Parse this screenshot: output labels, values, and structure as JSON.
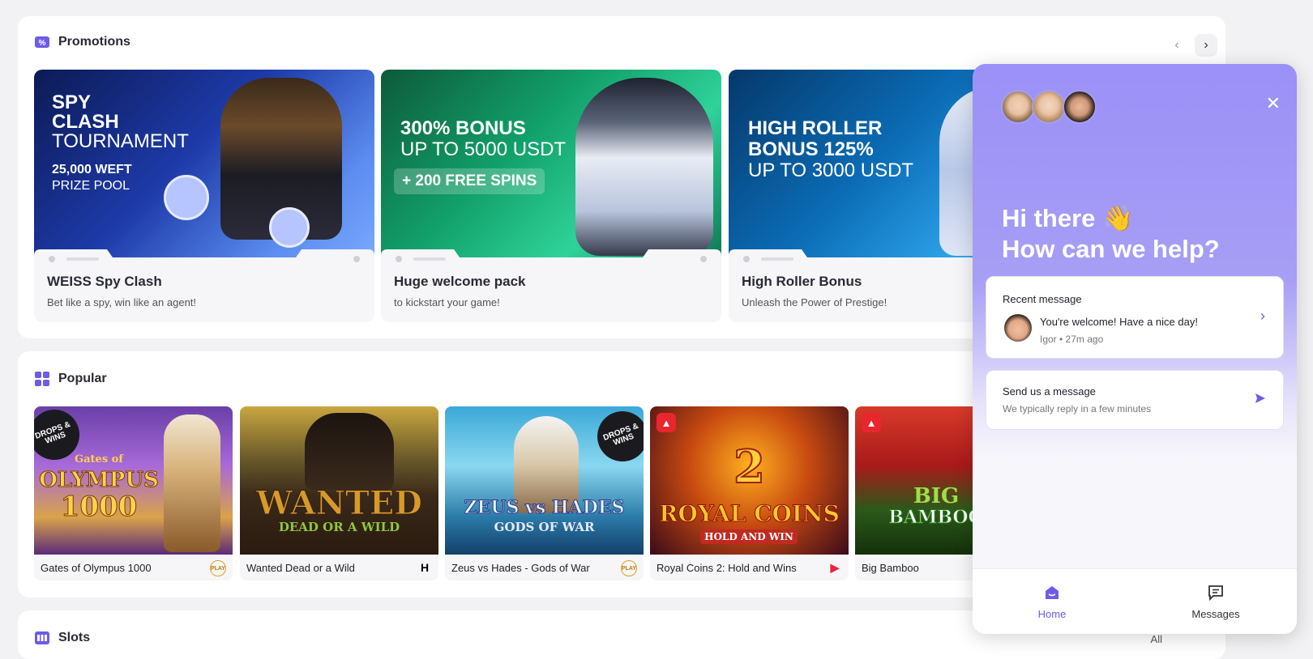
{
  "promotions": {
    "title": "Promotions",
    "cards": [
      {
        "banner_line1": "SPY",
        "banner_line2": "CLASH",
        "banner_line3": "TOURNAMENT",
        "banner_line4": "25,000 WEFT",
        "banner_line5": "PRIZE POOL",
        "title": "WEISS Spy Clash",
        "subtitle": "Bet like a spy, win like an agent!"
      },
      {
        "banner_line1": "300% BONUS",
        "banner_line2": "UP TO 5000 USDT",
        "banner_line3": "+ 200 FREE SPINS",
        "title": "Huge welcome pack",
        "subtitle": "to kickstart your game!"
      },
      {
        "banner_line1": "HIGH ROLLER",
        "banner_line2": "BONUS 125%",
        "banner_line3": "UP TO 3000 USDT",
        "title": "High Roller Bonus",
        "subtitle": "Unleash the Power of Prestige!"
      }
    ],
    "prev_icon": "‹",
    "next_icon": "›"
  },
  "popular": {
    "title": "Popular",
    "games": [
      {
        "name": "Gates of Olympus 1000",
        "art_line1": "Gates of",
        "art_line2": "OLYMPUS",
        "art_line3": "1000",
        "badge": "DROPS & WINS",
        "provider": "PLAY"
      },
      {
        "name": "Wanted Dead or a Wild",
        "art_line1": "WANTED",
        "art_line2": "DEAD OR A WILD",
        "provider": "H"
      },
      {
        "name": "Zeus vs Hades - Gods of War",
        "art_line1": "ZEUS vs HADES",
        "art_line2": "GODS OF WAR",
        "badge": "DROPS & WINS",
        "provider": "PLAY"
      },
      {
        "name": "Royal Coins 2: Hold and Wins",
        "art_line1": "2",
        "art_line2": "ROYAL COINS",
        "art_line3": "HOLD AND WIN",
        "provider": "▶"
      },
      {
        "name": "Big Bamboo",
        "art_line1": "BIG",
        "art_line2": "BAMBOO",
        "provider": ""
      }
    ]
  },
  "slots": {
    "title": "Slots",
    "all_label": "All"
  },
  "chat": {
    "greeting_line1": "Hi there 👋",
    "greeting_line2": "How can we help?",
    "close_icon": "✕",
    "recent": {
      "heading": "Recent message",
      "message": "You're welcome! Have a nice day!",
      "meta": "Igor • 27m ago"
    },
    "send": {
      "title": "Send us a message",
      "subtitle": "We typically reply in a few minutes"
    },
    "tabs": {
      "home": "Home",
      "messages": "Messages"
    },
    "colors": {
      "accent": "#6c5ce7",
      "header": "#9b90f7"
    }
  }
}
